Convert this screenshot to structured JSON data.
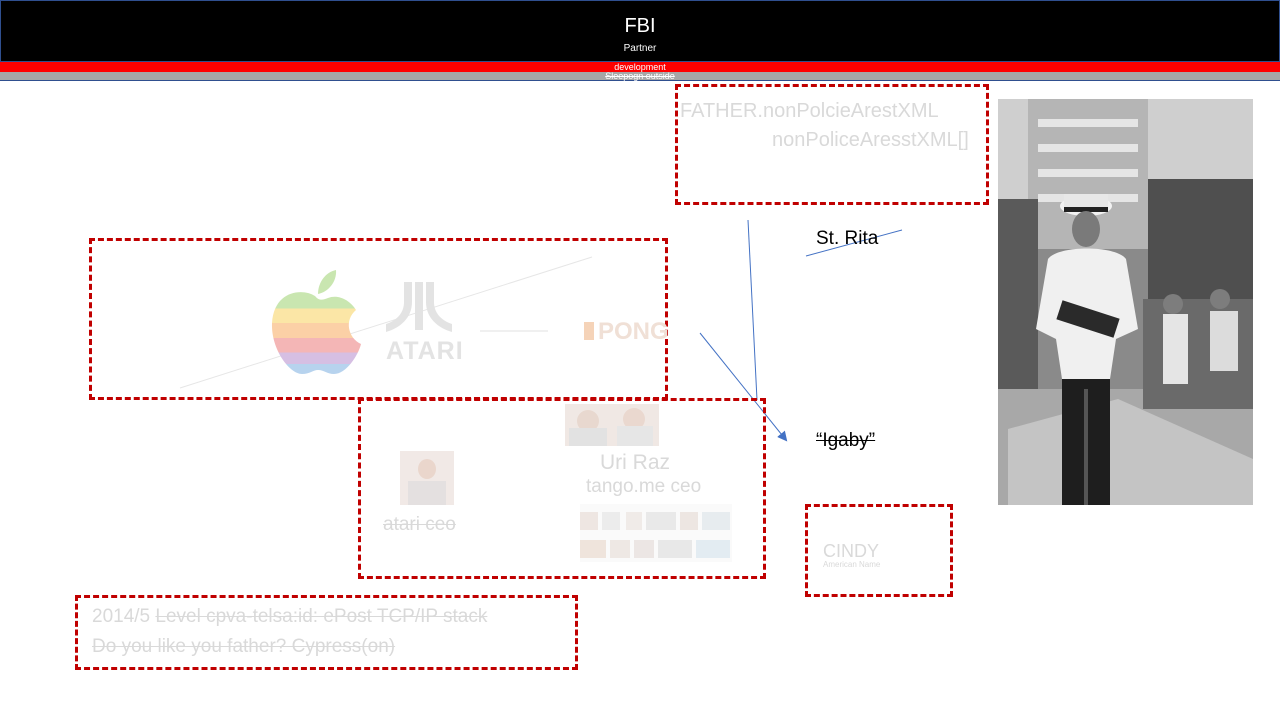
{
  "header": {
    "title": "FBI",
    "subtitle": "Partner",
    "bar_red_label": "development",
    "bar_gray_label": "Sleepogn outside"
  },
  "xml": {
    "line1": "FATHER.nonPolcieArestXML",
    "line2": "nonPoliceAresstXML[]"
  },
  "labels": {
    "st_rita": "St. Rita",
    "igaby": "“Igaby”",
    "cindy": "CINDY",
    "cindy_sub": "American Name"
  },
  "logos": {
    "atari": "ATARI",
    "pong": "PONG"
  },
  "people": {
    "uri_name": "Uri Raz",
    "uri_title": "tango.me ceo",
    "atari_ceo": "atari ceo"
  },
  "footer": {
    "line1_plain": "2014/5",
    "line1_struck": "Level cpva-telsa:id:  ePost TCP/IP stack",
    "line2_struck": "Do you like you father? Cypress(on)"
  },
  "colors": {
    "dashed_box": "#c00000",
    "header_bg": "#000000",
    "red_bar": "#ff0000",
    "gray_bar": "#a6a6a6",
    "arrow": "#4472c4"
  }
}
